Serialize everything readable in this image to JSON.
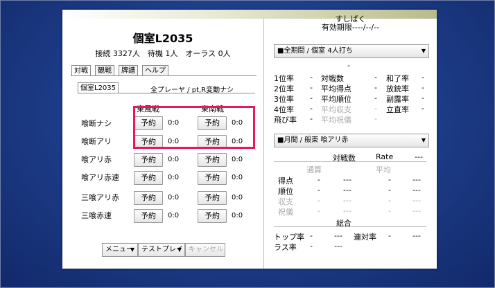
{
  "window": {
    "title": ""
  },
  "room": {
    "title": "個室L2035",
    "stats": "接続 3327人　待機 1人　オーラス 0人"
  },
  "tabs": [
    "対戦",
    "観戦",
    "牌譜",
    "ヘルプ"
  ],
  "subtab": {
    "label": "個室L2035",
    "info": "全プレーヤ / pt,R変動ナシ"
  },
  "columns": {
    "tonpu": "東風戦",
    "tonnan": "東南戦"
  },
  "reserve_label": "予約",
  "rules": [
    {
      "label": "喰断ナシ",
      "tonpu_score": "0:0",
      "tonnan_score": "0:0"
    },
    {
      "label": "喰断アリ",
      "tonpu_score": "0:0",
      "tonnan_score": "0:0"
    },
    {
      "label": "喰アリ赤",
      "tonpu_score": "0:0",
      "tonnan_score": "0:0"
    },
    {
      "label": "喰アリ赤速",
      "tonpu_score": "0:0",
      "tonnan_score": "0:0"
    },
    {
      "label": "三喰アリ赤",
      "tonpu_score": "0:0",
      "tonnan_score": "0:0"
    },
    {
      "label": "三喰赤速",
      "tonpu_score": "0:0",
      "tonnan_score": "0:0"
    }
  ],
  "bottom": {
    "menu": "メニュー",
    "testplay": "テストプレイ",
    "cancel": "キャンセル"
  },
  "player": {
    "name": "すしばく",
    "expiry": "有効期限----/--/--"
  },
  "period1": {
    "dropdown": "■全期間 / 個室 4人打ち",
    "dash": "-",
    "rows": [
      {
        "l1": "1位率",
        "v1": "-",
        "l2": "対戦数",
        "v2": "-",
        "l3": "和了率",
        "v3": "-"
      },
      {
        "l1": "2位率",
        "v1": "-",
        "l2": "平均得点",
        "v2": "-",
        "l3": "放銃率",
        "v3": "-"
      },
      {
        "l1": "3位率",
        "v1": "-",
        "l2": "平均順位",
        "v2": "-",
        "l3": "副露率",
        "v3": "-"
      },
      {
        "l1": "4位率",
        "v1": "-",
        "l2": "平均収支",
        "v2": "-",
        "l3": "立直率",
        "v3": "-"
      },
      {
        "l1": "飛び率",
        "v1": "-",
        "l2": "平均祝儀",
        "v2": "-"
      }
    ]
  },
  "period2": {
    "dropdown": "■月間 / 般東 喰アリ赤",
    "header_games": "対戦数",
    "header_rate": "Rate",
    "header_rate_val": "---",
    "normal": "通算",
    "average": "平均",
    "rows": [
      {
        "label": "得点",
        "a": "-",
        "b": "---",
        "c": "-",
        "d": "---"
      },
      {
        "label": "順位",
        "a": "-",
        "b": "---",
        "c": "-",
        "d": "---"
      },
      {
        "label": "収支",
        "a": "-",
        "b": "---",
        "c": "-",
        "d": "---"
      },
      {
        "label": "祝儀",
        "a": "-",
        "b": "---",
        "c": "-",
        "d": "---"
      }
    ],
    "total": "総合",
    "top_label": "トップ率",
    "top_a": "-",
    "top_b": "---",
    "rentai_label": "連対率",
    "rentai_a": "-",
    "rentai_b": "---",
    "las_label": "ラス率",
    "las_a": "-",
    "las_b": "---"
  }
}
